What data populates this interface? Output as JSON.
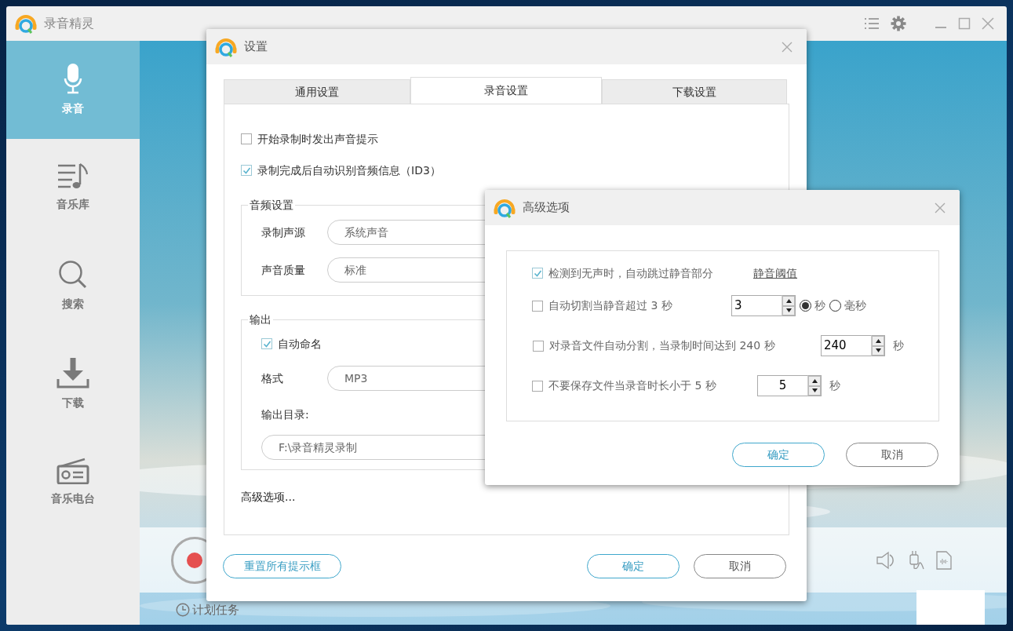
{
  "main_window": {
    "title": "录音精灵",
    "sidebar": {
      "items": [
        {
          "label": "录音",
          "selected": true
        },
        {
          "label": "音乐库",
          "selected": false
        },
        {
          "label": "搜索",
          "selected": false
        },
        {
          "label": "下载",
          "selected": false
        },
        {
          "label": "音乐电台",
          "selected": false
        }
      ]
    },
    "schedule_label": "计划任务"
  },
  "settings_dialog": {
    "title": "设置",
    "tabs": [
      {
        "label": "通用设置",
        "selected": false
      },
      {
        "label": "录音设置",
        "selected": true
      },
      {
        "label": "下载设置",
        "selected": false
      }
    ],
    "options": [
      {
        "label": "开始录制时发出声音提示",
        "checked": false
      },
      {
        "label": "录制完成后自动识别音频信息（ID3）",
        "checked": true
      }
    ],
    "audio_group": {
      "legend": "音频设置",
      "rows": [
        {
          "label": "录制声源",
          "value": "系统声音"
        },
        {
          "label": "声音质量",
          "value": "标准"
        }
      ]
    },
    "output_group": {
      "legend": "输出",
      "auto_name": {
        "label": "自动命名",
        "checked": true
      },
      "format": {
        "label": "格式",
        "value": "MP3"
      },
      "dir_label": "输出目录:",
      "dir_value": "F:\\录音精灵录制"
    },
    "advanced_link": "高级选项...",
    "buttons": {
      "reset": "重置所有提示框",
      "ok": "确定",
      "cancel": "取消"
    }
  },
  "advanced_dialog": {
    "title": "高级选项",
    "rows": [
      {
        "label": "检测到无声时，自动跳过静音部分",
        "checked": true,
        "link": "静音阈值"
      },
      {
        "label": "自动切割当静音超过 3 秒",
        "checked": false,
        "value": "3",
        "units": [
          {
            "label": "秒",
            "selected": true
          },
          {
            "label": "毫秒",
            "selected": false
          }
        ]
      },
      {
        "label": "对录音文件自动分割，当录制时间达到 240 秒",
        "checked": false,
        "value": "240",
        "unit": "秒"
      },
      {
        "label": "不要保存文件当录音时长小于 5 秒",
        "checked": false,
        "value": "5",
        "unit": "秒"
      }
    ],
    "buttons": {
      "ok": "确定",
      "cancel": "取消"
    }
  }
}
